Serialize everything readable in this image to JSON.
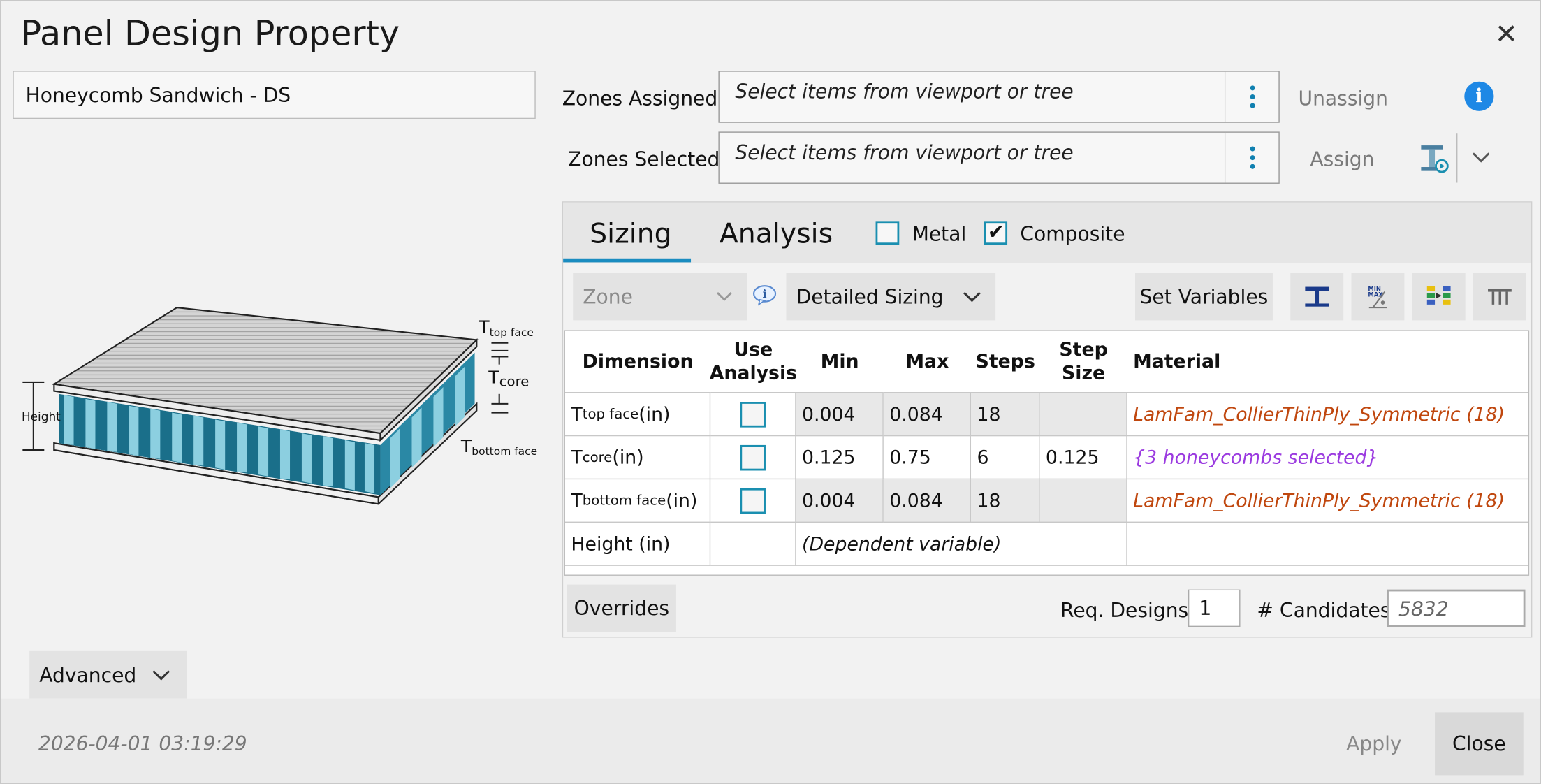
{
  "dialog": {
    "title": "Panel Design Property",
    "close_glyph": "✕"
  },
  "property_name": "Honeycomb Sandwich - DS",
  "diagram": {
    "label_top_face_main": "T",
    "label_top_face_sub": "top face",
    "label_core_main": "T",
    "label_core_sub": "core",
    "label_bottom_face_main": "T",
    "label_bottom_face_sub": "bottom face",
    "label_height": "Height"
  },
  "zones": {
    "assigned_label": "Zones Assigned:",
    "selected_label": "Zones Selected:",
    "placeholder": "Select items from viewport or tree",
    "unassign_label": "Unassign",
    "assign_label": "Assign",
    "info_glyph": "i"
  },
  "tabs": {
    "sizing": "Sizing",
    "analysis": "Analysis",
    "active": "Sizing"
  },
  "materials": {
    "metal_label": "Metal",
    "metal_checked": false,
    "composite_label": "Composite",
    "composite_checked": true
  },
  "toolbar": {
    "zone_dropdown": "Zone",
    "sizing_mode": "Detailed Sizing",
    "set_variables": "Set Variables"
  },
  "table": {
    "headers": {
      "dimension": "Dimension",
      "use_analysis_1": "Use",
      "use_analysis_2": "Analysis",
      "min": "Min",
      "max": "Max",
      "steps": "Steps",
      "step_size_1": "Step",
      "step_size_2": "Size",
      "material": "Material"
    },
    "rows": [
      {
        "dim_main": "T",
        "dim_sub": "top face",
        "dim_unit": " (in)",
        "min": "0.004",
        "max": "0.084",
        "steps": "18",
        "step_size": "",
        "material": "LamFam_CollierThinPly_Symmetric (18)"
      },
      {
        "dim_main": "T",
        "dim_sub": "core",
        "dim_unit": " (in)",
        "min": "0.125",
        "max": "0.75",
        "steps": "6",
        "step_size": "0.125",
        "material": "{3 honeycombs selected}"
      },
      {
        "dim_main": "T",
        "dim_sub": "bottom face",
        "dim_unit": " (in)",
        "min": "0.004",
        "max": "0.084",
        "steps": "18",
        "step_size": "",
        "material": "LamFam_CollierThinPly_Symmetric (18)"
      },
      {
        "dim_main": "Height (in)",
        "dependent": "(Dependent variable)"
      }
    ]
  },
  "bottom": {
    "overrides": "Overrides",
    "req_designs_label": "Req. Designs",
    "req_designs_value": "1",
    "candidates_label": "# Candidates",
    "candidates_value": "5832"
  },
  "advanced_label": "Advanced",
  "footer": {
    "timestamp": "2026-04-01 03:19:29",
    "apply": "Apply",
    "close": "Close"
  },
  "colors": {
    "accent": "#1a8cc0",
    "material": "#c0470e",
    "honeycomb": "#9b3be0",
    "info": "#1e88e5"
  }
}
